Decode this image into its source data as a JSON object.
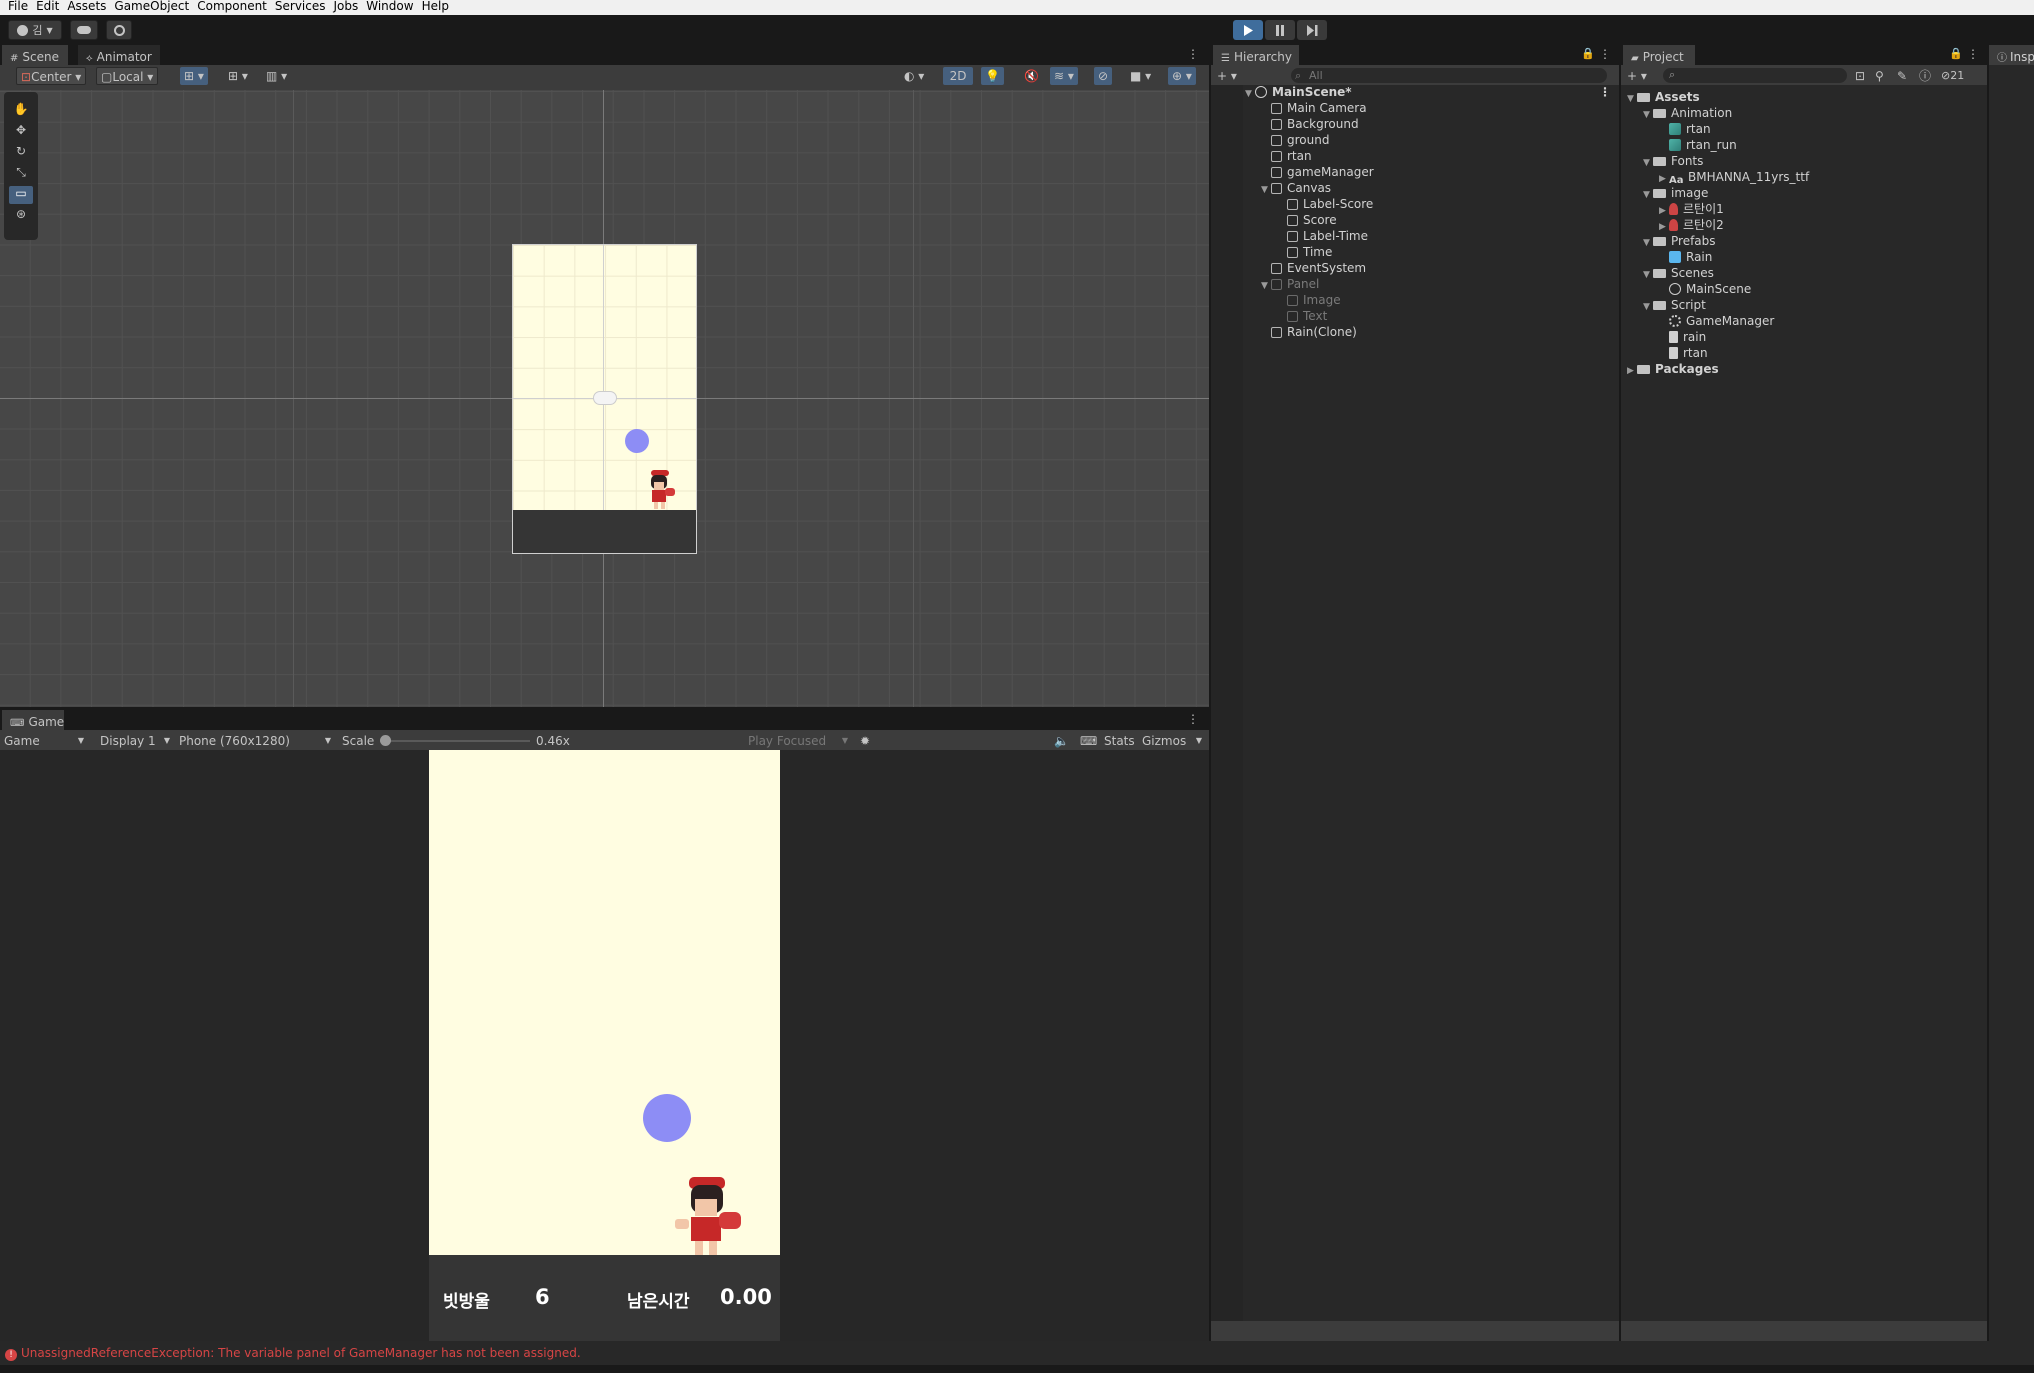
{
  "menu": [
    "File",
    "Edit",
    "Assets",
    "GameObject",
    "Component",
    "Services",
    "Jobs",
    "Window",
    "Help"
  ],
  "toolbar": {
    "account": "김",
    "layers": "21"
  },
  "scene_tabs": [
    "Scene",
    "Animator"
  ],
  "scene_toolbar": {
    "pivot": "Center",
    "space": "Local",
    "mode_2d": "2D"
  },
  "hierarchy": {
    "title": "Hierarchy",
    "search": "All",
    "scene": "MainScene*",
    "items": [
      {
        "label": "Main Camera",
        "depth": 1,
        "dim": false,
        "arrow": ""
      },
      {
        "label": "Background",
        "depth": 1,
        "dim": false,
        "arrow": ""
      },
      {
        "label": "ground",
        "depth": 1,
        "dim": false,
        "arrow": ""
      },
      {
        "label": "rtan",
        "depth": 1,
        "dim": false,
        "arrow": ""
      },
      {
        "label": "gameManager",
        "depth": 1,
        "dim": false,
        "arrow": ""
      },
      {
        "label": "Canvas",
        "depth": 1,
        "dim": false,
        "arrow": "▼"
      },
      {
        "label": "Label-Score",
        "depth": 2,
        "dim": false,
        "arrow": ""
      },
      {
        "label": "Score",
        "depth": 2,
        "dim": false,
        "arrow": ""
      },
      {
        "label": "Label-Time",
        "depth": 2,
        "dim": false,
        "arrow": ""
      },
      {
        "label": "Time",
        "depth": 2,
        "dim": false,
        "arrow": ""
      },
      {
        "label": "EventSystem",
        "depth": 1,
        "dim": false,
        "arrow": ""
      },
      {
        "label": "Panel",
        "depth": 1,
        "dim": true,
        "arrow": "▼"
      },
      {
        "label": "Image",
        "depth": 2,
        "dim": true,
        "arrow": ""
      },
      {
        "label": "Text",
        "depth": 2,
        "dim": true,
        "arrow": ""
      },
      {
        "label": "Rain(Clone)",
        "depth": 1,
        "dim": false,
        "arrow": ""
      }
    ]
  },
  "project": {
    "title": "Project",
    "inspector_tab": "Insp",
    "items": [
      {
        "label": "Assets",
        "depth": 0,
        "type": "folder",
        "arrow": "▼",
        "bold": true
      },
      {
        "label": "Animation",
        "depth": 1,
        "type": "folder",
        "arrow": "▼"
      },
      {
        "label": "rtan",
        "depth": 2,
        "type": "anim",
        "arrow": ""
      },
      {
        "label": "rtan_run",
        "depth": 2,
        "type": "anim",
        "arrow": ""
      },
      {
        "label": "Fonts",
        "depth": 1,
        "type": "folder",
        "arrow": "▼"
      },
      {
        "label": "BMHANNA_11yrs_ttf",
        "depth": 2,
        "type": "font",
        "arrow": "▶"
      },
      {
        "label": "image",
        "depth": 1,
        "type": "folder",
        "arrow": "▼"
      },
      {
        "label": "르탄이1",
        "depth": 2,
        "type": "sprite",
        "arrow": "▶"
      },
      {
        "label": "르탄이2",
        "depth": 2,
        "type": "sprite",
        "arrow": "▶"
      },
      {
        "label": "Prefabs",
        "depth": 1,
        "type": "folder",
        "arrow": "▼"
      },
      {
        "label": "Rain",
        "depth": 2,
        "type": "prefab",
        "arrow": ""
      },
      {
        "label": "Scenes",
        "depth": 1,
        "type": "folder",
        "arrow": "▼"
      },
      {
        "label": "MainScene",
        "depth": 2,
        "type": "scene",
        "arrow": ""
      },
      {
        "label": "Script",
        "depth": 1,
        "type": "folder",
        "arrow": "▼"
      },
      {
        "label": "GameManager",
        "depth": 2,
        "type": "gear",
        "arrow": ""
      },
      {
        "label": "rain",
        "depth": 2,
        "type": "script",
        "arrow": ""
      },
      {
        "label": "rtan",
        "depth": 2,
        "type": "script",
        "arrow": ""
      },
      {
        "label": "Packages",
        "depth": 0,
        "type": "folder",
        "arrow": "▶",
        "bold": true
      }
    ]
  },
  "game": {
    "tab": "Game",
    "view": "Game",
    "display": "Display 1",
    "resolution": "Phone (760x1280)",
    "scale_label": "Scale",
    "scale_value": "0.46x",
    "play_focused": "Play Focused",
    "stats": "Stats",
    "gizmos": "Gizmos",
    "score_label": "빗방울",
    "score": "6",
    "time_label": "남은시간",
    "time": "0.00"
  },
  "console": {
    "message": "UnassignedReferenceException: The variable panel of GameManager has not been assigned."
  },
  "colors": {
    "accent": "#3f6d9c",
    "raindrop": "#8d8df5",
    "game_bg": "#fffde1",
    "ground": "#353535",
    "error": "#d64545"
  }
}
